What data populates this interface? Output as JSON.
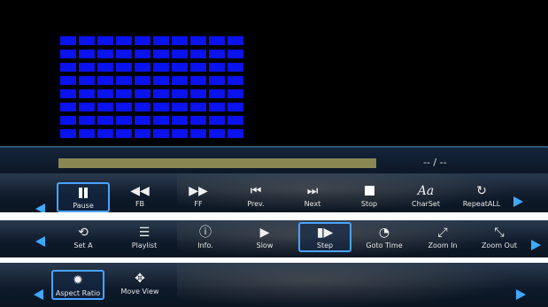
{
  "player": {
    "time_display": "-- / --"
  },
  "controls_row1": [
    {
      "label": "Pause",
      "icon": "pause-icon"
    },
    {
      "label": "FB",
      "icon": "rewind-icon",
      "glyph": "◀◀"
    },
    {
      "label": "FF",
      "icon": "fast-forward-icon",
      "glyph": "▶▶"
    },
    {
      "label": "Prev.",
      "icon": "previous-icon",
      "glyph": "⏮"
    },
    {
      "label": "Next",
      "icon": "next-icon",
      "glyph": "⏭"
    },
    {
      "label": "Stop",
      "icon": "stop-icon"
    },
    {
      "label": "CharSet",
      "icon": "charset-icon",
      "glyph": "Aa"
    },
    {
      "label": "RepeatALL",
      "icon": "repeat-icon",
      "glyph": "↻"
    }
  ],
  "controls_row2": [
    {
      "label": "Set A",
      "icon": "set-a-icon",
      "glyph": "⟲"
    },
    {
      "label": "Playlist",
      "icon": "playlist-icon",
      "glyph": "☰"
    },
    {
      "label": "Info.",
      "icon": "info-icon",
      "glyph": "ⓘ"
    },
    {
      "label": "Slow",
      "icon": "slow-icon",
      "glyph": "▶"
    },
    {
      "label": "Step",
      "icon": "step-icon",
      "glyph": "▮▶"
    },
    {
      "label": "Goto Time",
      "icon": "clock-icon",
      "glyph": "◔"
    },
    {
      "label": "Zoom In",
      "icon": "zoom-in-icon",
      "glyph": "⤢"
    },
    {
      "label": "Zoom Out",
      "icon": "zoom-out-icon",
      "glyph": "⤡"
    }
  ],
  "controls_row3": [
    {
      "label": "Aspect Ratio",
      "icon": "gear-icon",
      "glyph": "✹"
    },
    {
      "label": "Move View",
      "icon": "move-icon",
      "glyph": "✥"
    }
  ],
  "colors": {
    "accent": "#3fa8ff",
    "grid": "#0a12ee",
    "progress": "#8a8753"
  }
}
